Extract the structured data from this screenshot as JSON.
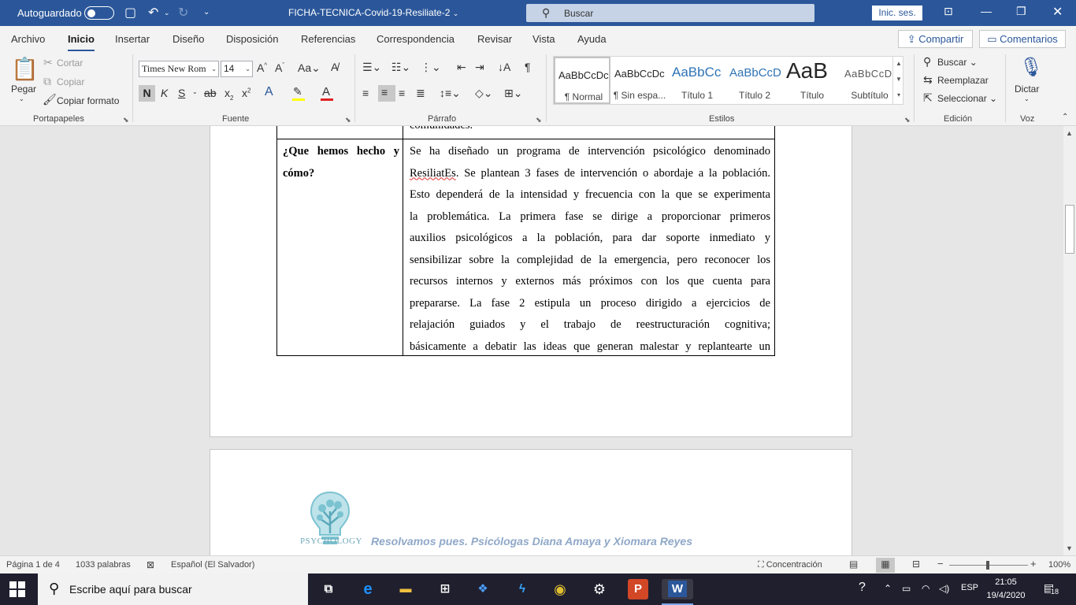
{
  "titlebar": {
    "autosave_label": "Autoguardado",
    "doc_title": "FICHA-TECNICA-Covid-19-Resiliate-2",
    "doc_title_arrow": "⌄",
    "search_placeholder": "Buscar",
    "signin_label": "Inic. ses."
  },
  "tabs": [
    "Archivo",
    "Inicio",
    "Insertar",
    "Diseño",
    "Disposición",
    "Referencias",
    "Correspondencia",
    "Revisar",
    "Vista",
    "Ayuda"
  ],
  "share_label": "Compartir",
  "comments_label": "Comentarios",
  "ribbon": {
    "clipboard": {
      "paste": "Pegar",
      "cut": "Cortar",
      "copy": "Copiar",
      "format_painter": "Copiar formato",
      "group": "Portapapeles"
    },
    "font": {
      "family": "Times New Rom",
      "size": "14",
      "group": "Fuente"
    },
    "paragraph": {
      "group": "Párrafo"
    },
    "styles": {
      "group": "Estilos",
      "items": [
        {
          "preview": "AaBbCcDc",
          "name": "¶ Normal"
        },
        {
          "preview": "AaBbCcDc",
          "name": "¶ Sin espa..."
        },
        {
          "preview": "AaBbCc",
          "name": "Título 1"
        },
        {
          "preview": "AaBbCcD",
          "name": "Título 2"
        },
        {
          "preview": "AaB",
          "name": "Título"
        },
        {
          "preview": "AaBbCcD",
          "name": "Subtítulo"
        }
      ]
    },
    "editing": {
      "find": "Buscar",
      "replace": "Reemplazar",
      "select": "Seleccionar",
      "group": "Edición"
    },
    "voice": {
      "dictate": "Dictar",
      "group": "Voz"
    }
  },
  "document": {
    "top_row_text": "comunidades.",
    "question": "¿Que hemos hecho y cómo?",
    "answer_lines": [
      "Se ha diseñado un programa de intervención psicológico denominado",
      "ResiliatEs. Se plantean 3 fases de intervención o abordaje a la población.",
      "Esto dependerá de la intensidad y frecuencia con la que se experimenta",
      "la problemática. La primera fase se dirige a proporcionar primeros",
      "auxilios psicológicos a la población, para dar soporte inmediato y",
      "sensibilizar sobre la complejidad de la emergencia, pero reconocer los",
      "recursos internos y externos más próximos con los que cuenta para",
      "prepararse. La fase 2 estipula un proceso dirigido a ejercicios de",
      "relajación guiados y el trabajo de reestructuración cognitiva;",
      "básicamente a debatir las ideas que generan malestar y replantearte un"
    ],
    "misspelled_word": "ResiliatEs",
    "logo_text": "PSYCHOLOGY",
    "footer_text": "Resolvamos pues. Psicólogas Diana Amaya y Xiomara Reyes"
  },
  "statusbar": {
    "page": "Página 1 de 4",
    "words": "1033 palabras",
    "language": "Español (El Salvador)",
    "focus": "Concentración",
    "zoom": "100%"
  },
  "taskbar": {
    "search_placeholder": "Escribe aquí para buscar",
    "lang": "ESP",
    "time": "21:05",
    "date": "19/4/2020",
    "notifications": "18"
  }
}
